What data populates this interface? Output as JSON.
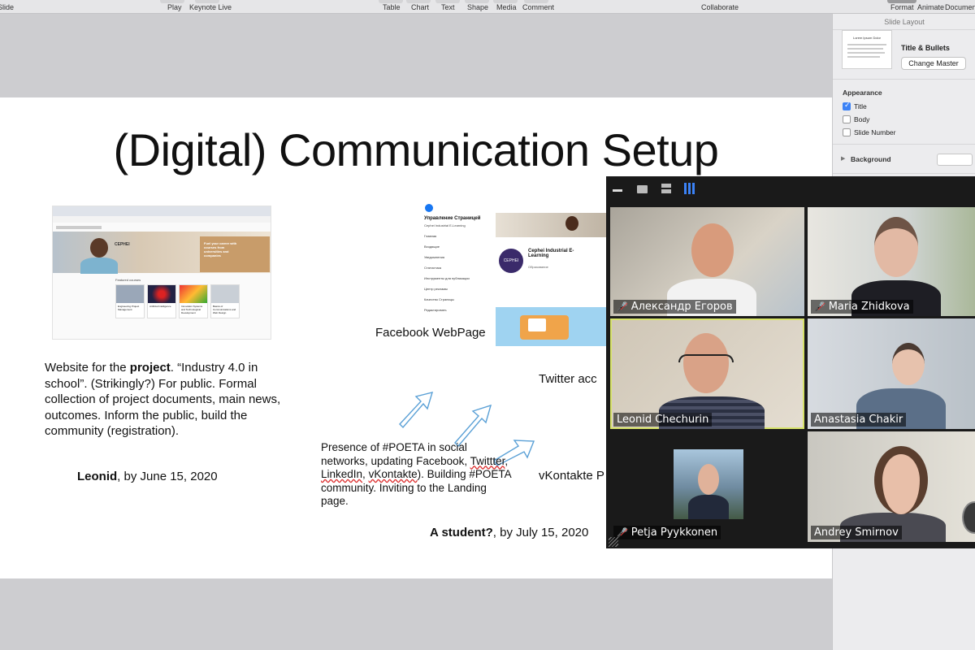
{
  "toolbar": {
    "items": [
      {
        "label": "Slide"
      },
      {
        "label": "Play"
      },
      {
        "label": "Keynote Live"
      },
      {
        "label": "Table"
      },
      {
        "label": "Chart"
      },
      {
        "label": "Text"
      },
      {
        "label": "Shape"
      },
      {
        "label": "Media"
      },
      {
        "label": "Comment"
      },
      {
        "label": "Collaborate"
      },
      {
        "label": "Format"
      },
      {
        "label": "Animate"
      },
      {
        "label": "Document"
      }
    ]
  },
  "inspector": {
    "header": "Slide Layout",
    "layout_name": "Title & Bullets",
    "change_master_label": "Change Master",
    "thumb_title": "Lorem Ipsum Dolor",
    "appearance_label": "Appearance",
    "checkboxes": [
      {
        "label": "Title",
        "checked": true
      },
      {
        "label": "Body",
        "checked": false
      },
      {
        "label": "Slide Number",
        "checked": false
      }
    ],
    "background_label": "Background"
  },
  "slide": {
    "title": "(Digital) Communication Setup",
    "website_text_1": "Website for the ",
    "website_bold": "project",
    "website_text_2": ". “Industry 4.0 in school”. (Strikingly?) For public. Formal collection of project documents, main news, outcomes. Inform the public, build the community (registration).",
    "website_owner_bold": "Leonid",
    "website_owner_rest": ", by June 15, 2020",
    "facebook_label": "Facebook WebPage",
    "twitter_label": "Twitter  acc",
    "vk_label": "vKontakte P",
    "social_text_1": "Presence of #POETA in social networks, updating Facebook, ",
    "social_twitter": "Twittter",
    "social_comma": ", ",
    "social_linkedin": "LinkedIn",
    "social_comma2": ", ",
    "social_vk": "vKontakte",
    "social_text_2": "). Building #POETA community. Inviting to the Landing page.",
    "student_bold": "A student?",
    "student_rest": ", by July 15, 2020",
    "site_thumb": {
      "logo": "CEPHEI",
      "hero_text": "Fuel your career with courses from universities and companies",
      "section": "Featured courses",
      "courses": [
        "Engineering Project Management",
        "Artificial Intelligence",
        "Innovation Systems and Technological Development",
        "Basics of Communications and Web Design"
      ]
    },
    "fb_thumb": {
      "header": "Управление Страницей",
      "sub": "Cephei Industrial E-Learning",
      "menu": [
        "Главная",
        "Входящие",
        "Уведомления",
        "Статистика",
        "Инструменты для публикации",
        "Центр рекламы",
        "Качество Страницы",
        "Редактировать"
      ],
      "page_name": "Cephei Industrial E-Learning",
      "page_cat": "Образование",
      "logo": "CEPHEI"
    }
  },
  "zoom": {
    "participants": [
      {
        "name": "Александр Егоров",
        "muted": true
      },
      {
        "name": "Maria Zhidkova",
        "muted": true
      },
      {
        "name": "Leonid Chechurin",
        "muted": false
      },
      {
        "name": "Anastasia Chakir",
        "muted": false
      },
      {
        "name": "Petja Pyykkonen",
        "muted": true
      },
      {
        "name": "Andrey Smirnov",
        "muted": false
      }
    ],
    "accent": "#d7e36a"
  }
}
